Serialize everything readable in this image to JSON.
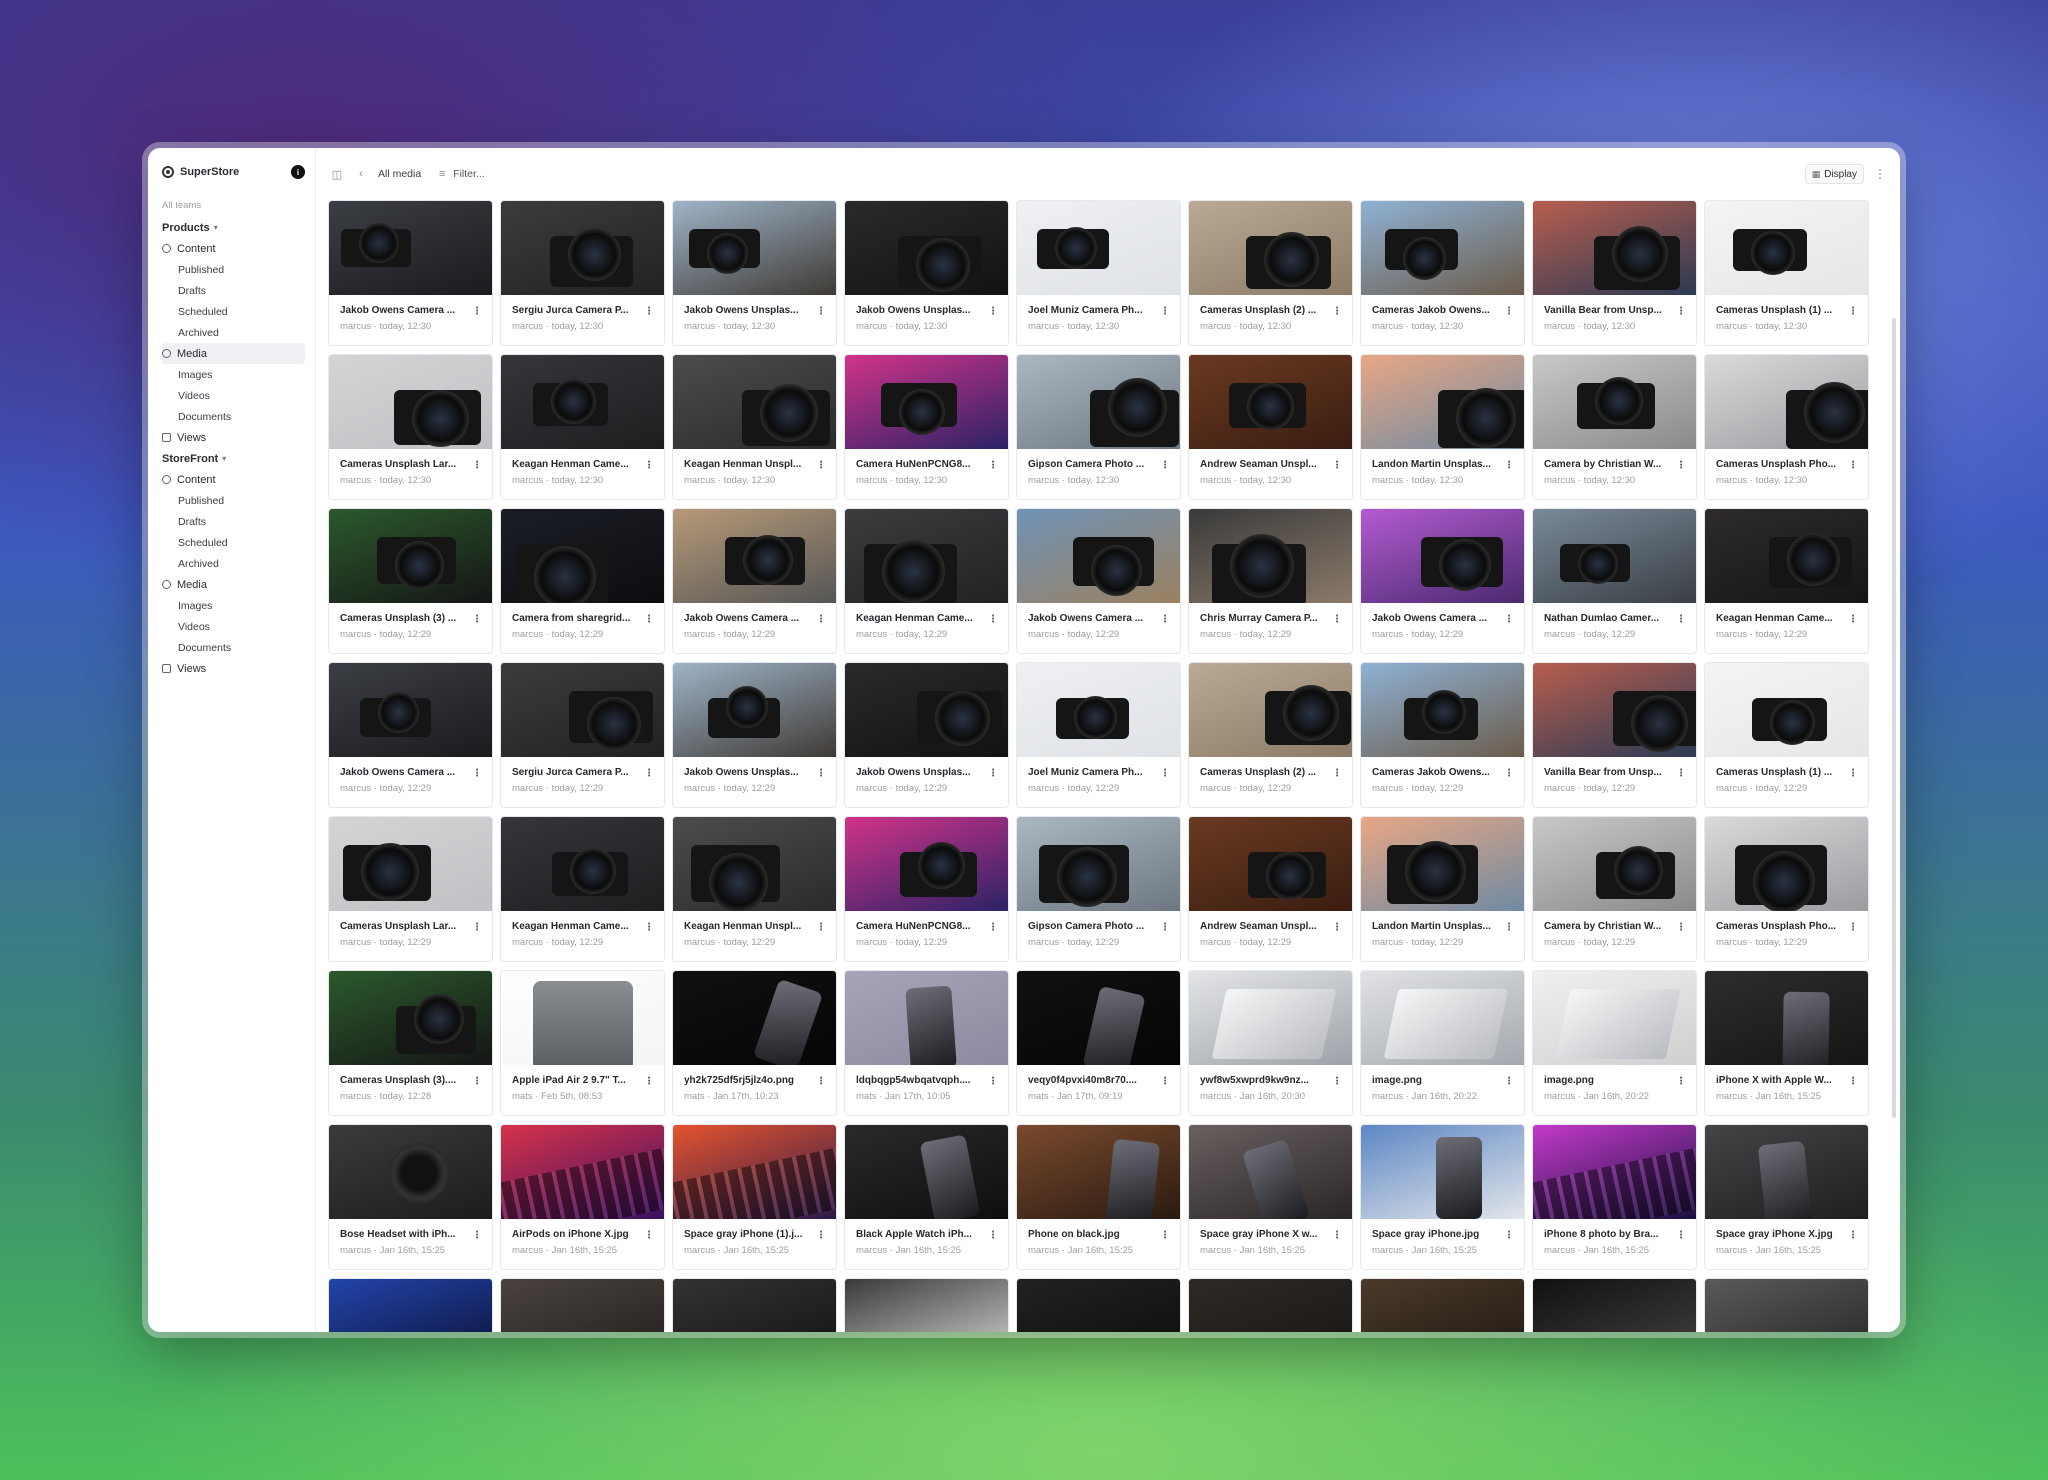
{
  "app": {
    "name": "SuperStore",
    "avatar_initial": "i"
  },
  "sidebar": {
    "all_teams_label": "All teams",
    "teams": [
      {
        "name": "Products",
        "sections": [
          {
            "label": "Content",
            "icon": "content-icon",
            "children": [
              "Published",
              "Drafts",
              "Scheduled",
              "Archived"
            ]
          },
          {
            "label": "Media",
            "icon": "media-icon",
            "active": true,
            "children": [
              "Images",
              "Videos",
              "Documents"
            ]
          },
          {
            "label": "Views",
            "icon": "views-icon",
            "children": []
          }
        ]
      },
      {
        "name": "StoreFront",
        "sections": [
          {
            "label": "Content",
            "icon": "content-icon",
            "children": [
              "Published",
              "Drafts",
              "Scheduled",
              "Archived"
            ]
          },
          {
            "label": "Media",
            "icon": "media-icon",
            "children": [
              "Images",
              "Videos",
              "Documents"
            ]
          },
          {
            "label": "Views",
            "icon": "views-icon",
            "children": []
          }
        ]
      }
    ]
  },
  "toolbar": {
    "breadcrumb": "All media",
    "filter_label": "Filter...",
    "display_label": "Display"
  },
  "media": [
    {
      "title": "Jakob Owens Camera ...",
      "sub": "marcus · today, 12:30",
      "colors": [
        "#3b3e44",
        "#1a1b1e"
      ],
      "motif": "camera"
    },
    {
      "title": "Sergiu Jurca Camera P...",
      "sub": "marcus · today, 12:30",
      "colors": [
        "#3c3c3c",
        "#222"
      ],
      "motif": "camera"
    },
    {
      "title": "Jakob Owens Unsplas...",
      "sub": "marcus · today, 12:30",
      "colors": [
        "#9fb4c8",
        "#3f3a35"
      ],
      "motif": "camera"
    },
    {
      "title": "Jakob Owens Unsplas...",
      "sub": "marcus · today, 12:30",
      "colors": [
        "#2a2a2c",
        "#121212"
      ],
      "motif": "camera"
    },
    {
      "title": "Joel Muniz Camera Ph...",
      "sub": "marcus · today, 12:30",
      "colors": [
        "#eef0f3",
        "#dfe2e6"
      ],
      "motif": "camera"
    },
    {
      "title": "Cameras Unsplash (2) ...",
      "sub": "marcus · today, 12:30",
      "colors": [
        "#b9a995",
        "#8c7b66"
      ],
      "motif": "camera"
    },
    {
      "title": "Cameras Jakob Owens...",
      "sub": "marcus · today, 12:30",
      "colors": [
        "#8fb2d4",
        "#6b5c4c"
      ],
      "motif": "camera"
    },
    {
      "title": "Vanilla Bear from Unsp...",
      "sub": "marcus · today, 12:30",
      "colors": [
        "#b85e4e",
        "#2c3a54"
      ],
      "motif": "camera"
    },
    {
      "title": "Cameras Unsplash (1) ...",
      "sub": "marcus · today, 12:30",
      "colors": [
        "#f4f4f4",
        "#e6e6e6"
      ],
      "motif": "camera"
    },
    {
      "title": "Cameras Unsplash Lar...",
      "sub": "marcus · today, 12:30",
      "colors": [
        "#d2d4d6",
        "#bfc1c4"
      ],
      "motif": "camera"
    },
    {
      "title": "Keagan Henman Came...",
      "sub": "marcus · today, 12:30",
      "colors": [
        "#34363a",
        "#1d1e20"
      ],
      "motif": "camera"
    },
    {
      "title": "Keagan Henman Unspl...",
      "sub": "marcus · today, 12:30",
      "colors": [
        "#4a4c4e",
        "#2a2b2c"
      ],
      "motif": "camera"
    },
    {
      "title": "Camera HuNenPCNG8...",
      "sub": "marcus · today, 12:30",
      "colors": [
        "#d1338a",
        "#2c2266"
      ],
      "motif": "camera"
    },
    {
      "title": "Gipson Camera Photo ...",
      "sub": "marcus · today, 12:30",
      "colors": [
        "#aab8c2",
        "#6d7780"
      ],
      "motif": "camera"
    },
    {
      "title": "Andrew Seaman Unspl...",
      "sub": "marcus · today, 12:30",
      "colors": [
        "#6a3a22",
        "#3a1d10"
      ],
      "motif": "camera"
    },
    {
      "title": "Landon Martin Unsplas...",
      "sub": "marcus · today, 12:30",
      "colors": [
        "#e8a784",
        "#6f8aa2"
      ],
      "motif": "camera"
    },
    {
      "title": "Camera by Christian W...",
      "sub": "marcus · today, 12:30",
      "colors": [
        "#c8c8c8",
        "#8a8a8a"
      ],
      "motif": "camera"
    },
    {
      "title": "Cameras Unsplash Pho...",
      "sub": "marcus · today, 12:30",
      "colors": [
        "#d9dadc",
        "#9a9c9f"
      ],
      "motif": "camera"
    },
    {
      "title": "Cameras Unsplash (3) ...",
      "sub": "marcus · today, 12:29",
      "colors": [
        "#2b5a2c",
        "#151515"
      ],
      "motif": "camera"
    },
    {
      "title": "Camera from sharegrid...",
      "sub": "marcus · today, 12:29",
      "colors": [
        "#1b1e26",
        "#0c0d10"
      ],
      "motif": "camera"
    },
    {
      "title": "Jakob Owens Camera ...",
      "sub": "marcus · today, 12:29",
      "colors": [
        "#b79a78",
        "#555"
      ],
      "motif": "camera"
    },
    {
      "title": "Keagan Henman Came...",
      "sub": "marcus · today, 12:29",
      "colors": [
        "#3a3c3e",
        "#222"
      ],
      "motif": "camera"
    },
    {
      "title": "Jakob Owens Camera ...",
      "sub": "marcus · today, 12:29",
      "colors": [
        "#6f92b6",
        "#9b8160"
      ],
      "motif": "camera"
    },
    {
      "title": "Chris Murray Camera P...",
      "sub": "marcus · today, 12:29",
      "colors": [
        "#3a3a3a",
        "#8a7a6a"
      ],
      "motif": "camera"
    },
    {
      "title": "Jakob Owens Camera ...",
      "sub": "marcus · today, 12:29",
      "colors": [
        "#b35bd1",
        "#4a2a6e"
      ],
      "motif": "camera"
    },
    {
      "title": "Nathan Dumlao Camer...",
      "sub": "marcus · today, 12:29",
      "colors": [
        "#7a8a99",
        "#3a3f44"
      ],
      "motif": "camera"
    },
    {
      "title": "Keagan Henman Came...",
      "sub": "marcus · today, 12:29",
      "colors": [
        "#2e2b2a",
        "#161515"
      ],
      "motif": "camera"
    },
    {
      "title": "Jakob Owens Camera ...",
      "sub": "marcus · today, 12:29",
      "colors": [
        "#3b3e44",
        "#1a1b1e"
      ],
      "motif": "camera"
    },
    {
      "title": "Sergiu Jurca Camera P...",
      "sub": "marcus · today, 12:29",
      "colors": [
        "#3c3c3c",
        "#222"
      ],
      "motif": "camera"
    },
    {
      "title": "Jakob Owens Unsplas...",
      "sub": "marcus · today, 12:29",
      "colors": [
        "#9fb4c8",
        "#3f3a35"
      ],
      "motif": "camera"
    },
    {
      "title": "Jakob Owens Unsplas...",
      "sub": "marcus · today, 12:29",
      "colors": [
        "#2a2a2c",
        "#121212"
      ],
      "motif": "camera"
    },
    {
      "title": "Joel Muniz Camera Ph...",
      "sub": "marcus · today, 12:29",
      "colors": [
        "#eef0f3",
        "#dfe2e6"
      ],
      "motif": "camera"
    },
    {
      "title": "Cameras Unsplash (2) ...",
      "sub": "marcus · today, 12:29",
      "colors": [
        "#b9a995",
        "#8c7b66"
      ],
      "motif": "camera"
    },
    {
      "title": "Cameras Jakob Owens...",
      "sub": "marcus · today, 12:29",
      "colors": [
        "#8fb2d4",
        "#6b5c4c"
      ],
      "motif": "camera"
    },
    {
      "title": "Vanilla Bear from Unsp...",
      "sub": "marcus · today, 12:29",
      "colors": [
        "#b85e4e",
        "#2c3a54"
      ],
      "motif": "camera"
    },
    {
      "title": "Cameras Unsplash (1) ...",
      "sub": "marcus · today, 12:29",
      "colors": [
        "#f4f4f4",
        "#e6e6e6"
      ],
      "motif": "camera"
    },
    {
      "title": "Cameras Unsplash Lar...",
      "sub": "marcus · today, 12:29",
      "colors": [
        "#d2d4d6",
        "#bfc1c4"
      ],
      "motif": "camera"
    },
    {
      "title": "Keagan Henman Came...",
      "sub": "marcus · today, 12:29",
      "colors": [
        "#34363a",
        "#1d1e20"
      ],
      "motif": "camera"
    },
    {
      "title": "Keagan Henman Unspl...",
      "sub": "marcus · today, 12:29",
      "colors": [
        "#4a4c4e",
        "#2a2b2c"
      ],
      "motif": "camera"
    },
    {
      "title": "Camera HuNenPCNG8...",
      "sub": "marcus · today, 12:29",
      "colors": [
        "#d1338a",
        "#2c2266"
      ],
      "motif": "camera"
    },
    {
      "title": "Gipson Camera Photo ...",
      "sub": "marcus · today, 12:29",
      "colors": [
        "#aab8c2",
        "#6d7780"
      ],
      "motif": "camera"
    },
    {
      "title": "Andrew Seaman Unspl...",
      "sub": "marcus · today, 12:29",
      "colors": [
        "#6a3a22",
        "#3a1d10"
      ],
      "motif": "camera"
    },
    {
      "title": "Landon Martin Unsplas...",
      "sub": "marcus · today, 12:29",
      "colors": [
        "#e8a784",
        "#6f8aa2"
      ],
      "motif": "camera"
    },
    {
      "title": "Camera by Christian W...",
      "sub": "marcus · today, 12:29",
      "colors": [
        "#c8c8c8",
        "#8a8a8a"
      ],
      "motif": "camera"
    },
    {
      "title": "Cameras Unsplash Pho...",
      "sub": "marcus · today, 12:29",
      "colors": [
        "#d9dadc",
        "#9a9c9f"
      ],
      "motif": "camera"
    },
    {
      "title": "Cameras Unsplash (3)....",
      "sub": "marcus · today, 12:28",
      "colors": [
        "#2b5a2c",
        "#151515"
      ],
      "motif": "camera"
    },
    {
      "title": "Apple iPad Air 2 9.7\" T...",
      "sub": "mats · Feb 5th, 08:53",
      "colors": [
        "#ffffff",
        "#f4f4f4"
      ],
      "motif": "tablet"
    },
    {
      "title": "yh2k725df5rj5jlz4o.png",
      "sub": "mats · Jan 17th, 10:23",
      "colors": [
        "#111111",
        "#050505"
      ],
      "motif": "phone"
    },
    {
      "title": "ldqbqgp54wbqatvqph....",
      "sub": "mats · Jan 17th, 10:05",
      "colors": [
        "#a7a4b8",
        "#8d8aa1"
      ],
      "motif": "phone"
    },
    {
      "title": "veqy0f4pvxi40m8r70....",
      "sub": "mats · Jan 17th, 09:19",
      "colors": [
        "#111",
        "#050505"
      ],
      "motif": "phone"
    },
    {
      "title": "ywf8w5xwprd9kw9nz...",
      "sub": "marcus · Jan 16th, 20:30",
      "colors": [
        "#e3e5e8",
        "#9ea2a8"
      ],
      "motif": "laptop"
    },
    {
      "title": "image.png",
      "sub": "marcus · Jan 16th, 20:22",
      "colors": [
        "#e0e2e5",
        "#a4a8ae"
      ],
      "motif": "laptop"
    },
    {
      "title": "image.png",
      "sub": "marcus · Jan 16th, 20:22",
      "colors": [
        "#f0f0f0",
        "#cfcfcf"
      ],
      "motif": "laptop"
    },
    {
      "title": "iPhone X with Apple W...",
      "sub": "marcus · Jan 16th, 15:25",
      "colors": [
        "#2d2d2d",
        "#151515"
      ],
      "motif": "phone"
    },
    {
      "title": "Bose Headset with iPh...",
      "sub": "marcus · Jan 16th, 15:25",
      "colors": [
        "#3a3b3d",
        "#1b1c1d"
      ],
      "motif": "headset"
    },
    {
      "title": "AirPods on iPhone X.jpg",
      "sub": "marcus · Jan 16th, 15:25",
      "colors": [
        "#d8324a",
        "#3a1060"
      ],
      "motif": "keyboard"
    },
    {
      "title": "Space gray iPhone (1).j...",
      "sub": "marcus · Jan 16th, 15:25",
      "colors": [
        "#e5532f",
        "#2a1a4a"
      ],
      "motif": "keyboard"
    },
    {
      "title": "Black Apple Watch iPh...",
      "sub": "marcus · Jan 16th, 15:25",
      "colors": [
        "#2a2a2a",
        "#0e0e0e"
      ],
      "motif": "phone"
    },
    {
      "title": "Phone on black.jpg",
      "sub": "marcus · Jan 16th, 15:25",
      "colors": [
        "#7a4a2e",
        "#2a1a10"
      ],
      "motif": "phone"
    },
    {
      "title": "Space gray iPhone X w...",
      "sub": "marcus · Jan 16th, 15:25",
      "colors": [
        "#6a6060",
        "#2a2626"
      ],
      "motif": "phone"
    },
    {
      "title": "Space gray iPhone.jpg",
      "sub": "marcus · Jan 16th, 15:25",
      "colors": [
        "#5d87c4",
        "#e2e6ea"
      ],
      "motif": "phone"
    },
    {
      "title": "iPhone 8 photo by Bra...",
      "sub": "marcus · Jan 16th, 15:25",
      "colors": [
        "#c33ac9",
        "#1a1040"
      ],
      "motif": "keyboard"
    },
    {
      "title": "Space gray iPhone X.jpg",
      "sub": "marcus · Jan 16th, 15:25",
      "colors": [
        "#444446",
        "#1f1f20"
      ],
      "motif": "phone"
    },
    {
      "title": "",
      "sub": "",
      "colors": [
        "#2244aa",
        "#0a0f30"
      ],
      "motif": "none"
    },
    {
      "title": "",
      "sub": "",
      "colors": [
        "#4a4340",
        "#201c1a"
      ],
      "motif": "none"
    },
    {
      "title": "",
      "sub": "",
      "colors": [
        "#333",
        "#111"
      ],
      "motif": "none"
    },
    {
      "title": "",
      "sub": "",
      "colors": [
        "#3a3a3a",
        "#ddd"
      ],
      "motif": "none"
    },
    {
      "title": "",
      "sub": "",
      "colors": [
        "#222",
        "#0b0b0b"
      ],
      "motif": "none"
    },
    {
      "title": "",
      "sub": "",
      "colors": [
        "#2e2a26",
        "#161412"
      ],
      "motif": "none"
    },
    {
      "title": "",
      "sub": "",
      "colors": [
        "#4a3a2a",
        "#1c1610"
      ],
      "motif": "none"
    },
    {
      "title": "",
      "sub": "",
      "colors": [
        "#111",
        "#444"
      ],
      "motif": "none"
    },
    {
      "title": "",
      "sub": "",
      "colors": [
        "#5a5a5c",
        "#222"
      ],
      "motif": "none"
    }
  ]
}
